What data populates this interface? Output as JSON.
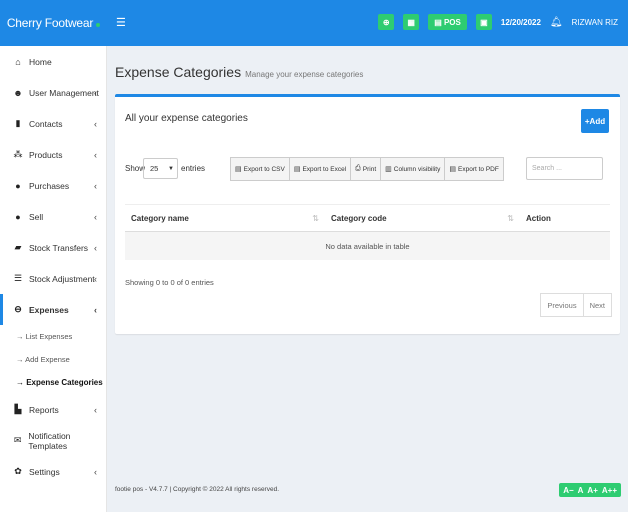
{
  "header": {
    "brand": "Cherry Footwear",
    "pos_label": "POS",
    "date": "12/20/2022",
    "user": "RIZWAN RIZ",
    "colors": {
      "primary": "#1e88e5",
      "accent": "#2ecc71"
    }
  },
  "sidebar": {
    "items": [
      {
        "label": "Home",
        "icon": "home-icon"
      },
      {
        "label": "User Management",
        "icon": "users-icon"
      },
      {
        "label": "Contacts",
        "icon": "address-book-icon"
      },
      {
        "label": "Products",
        "icon": "cubes-icon"
      },
      {
        "label": "Purchases",
        "icon": "arrow-circle-down-icon"
      },
      {
        "label": "Sell",
        "icon": "arrow-circle-up-icon"
      },
      {
        "label": "Stock Transfers",
        "icon": "truck-icon"
      },
      {
        "label": "Stock Adjustment",
        "icon": "database-icon"
      },
      {
        "label": "Expenses",
        "icon": "minus-circle-icon"
      },
      {
        "label": "Reports",
        "icon": "chart-icon"
      },
      {
        "label": "Notification Templates",
        "icon": "envelope-icon"
      },
      {
        "label": "Settings",
        "icon": "gear-icon"
      }
    ],
    "expenses_sub": [
      "→ List Expenses",
      "→ Add Expense",
      "→ Expense Categories"
    ]
  },
  "page": {
    "title": "Expense Categories",
    "subtitle": "Manage your expense categories",
    "box_title": "All your expense categories",
    "add_label": "+Add"
  },
  "table_controls": {
    "show_label": "Show",
    "page_length": "25",
    "entries_label": "entries",
    "exports": [
      "Export to CSV",
      "Export to Excel",
      "Print",
      "Column visibility",
      "Export to PDF"
    ],
    "search_placeholder": "Search ..."
  },
  "table": {
    "columns": [
      "Category name",
      "Category code",
      "Action"
    ],
    "empty_message": "No data available in table",
    "info": "Showing 0 to 0 of 0 entries",
    "pagination": {
      "previous": "Previous",
      "next": "Next"
    }
  },
  "footer": {
    "text": "footie pos - V4.7.7 | Copyright © 2022 All rights reserved.",
    "font_controls": [
      "A−",
      "A",
      "A+",
      "A++"
    ]
  }
}
